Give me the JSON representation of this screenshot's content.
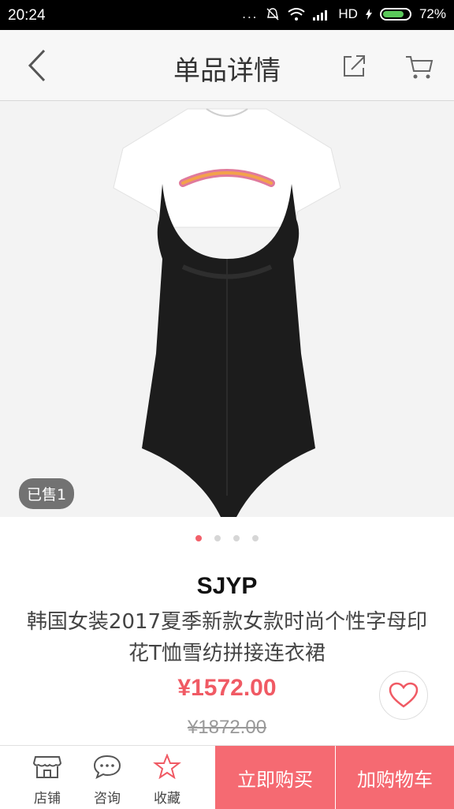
{
  "status_bar": {
    "time": "20:24",
    "dots": "...",
    "network": "HD",
    "battery_percent": "72%"
  },
  "nav": {
    "title": "单品详情"
  },
  "gallery": {
    "sold_badge": "已售1",
    "slide_count": 4,
    "active_slide": 1
  },
  "product": {
    "brand": "SJYP",
    "title": "韩国女装2017夏季新款女款时尚个性字母印花T恤雪纺拼接连衣裙",
    "price": "¥1572.00",
    "original_price": "¥1872.00"
  },
  "bottom_bar": {
    "store_label": "店铺",
    "consult_label": "咨询",
    "favorite_label": "收藏",
    "buy_now_label": "立即购买",
    "add_to_cart_label": "加购物车"
  },
  "colors": {
    "accent": "#f56a72",
    "price": "#f05a64",
    "active_dot": "#f2606a"
  }
}
